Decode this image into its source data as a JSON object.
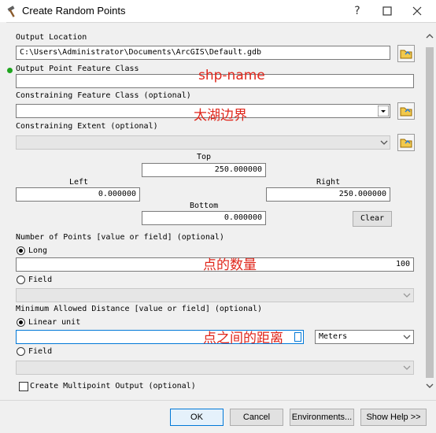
{
  "window": {
    "title": "Create Random Points"
  },
  "output_location": {
    "label": "Output Location",
    "value": "C:\\Users\\Administrator\\Documents\\ArcGIS\\Default.gdb"
  },
  "output_fc": {
    "label": "Output Point Feature Class",
    "value": "",
    "annotation": "shp-name"
  },
  "constraining_fc": {
    "label": "Constraining Feature Class (optional)",
    "value": "",
    "annotation": "太湖边界"
  },
  "constraining_extent": {
    "label": "Constraining Extent (optional)",
    "value": "",
    "top_label": "Top",
    "top_value": "250.000000",
    "left_label": "Left",
    "left_value": "0.000000",
    "right_label": "Right",
    "right_value": "250.000000",
    "bottom_label": "Bottom",
    "bottom_value": "0.000000",
    "clear_label": "Clear"
  },
  "num_points": {
    "label": "Number of Points [value or field] (optional)",
    "long_label": "Long",
    "long_value": "100",
    "field_label": "Field",
    "annotation": "点的数量"
  },
  "min_distance": {
    "label": "Minimum Allowed Distance [value or field] (optional)",
    "linear_label": "Linear unit",
    "linear_value": "",
    "unit": "Meters",
    "field_label": "Field",
    "annotation": "点之间的距离"
  },
  "multipoint": {
    "label": "Create Multipoint Output (optional)"
  },
  "buttons": {
    "ok": "OK",
    "cancel": "Cancel",
    "environments": "Environments...",
    "help": "Show Help >>"
  },
  "colors": {
    "accent": "#0078d7",
    "annotation": "#e0261b",
    "required_dot": "#1fa51f"
  }
}
